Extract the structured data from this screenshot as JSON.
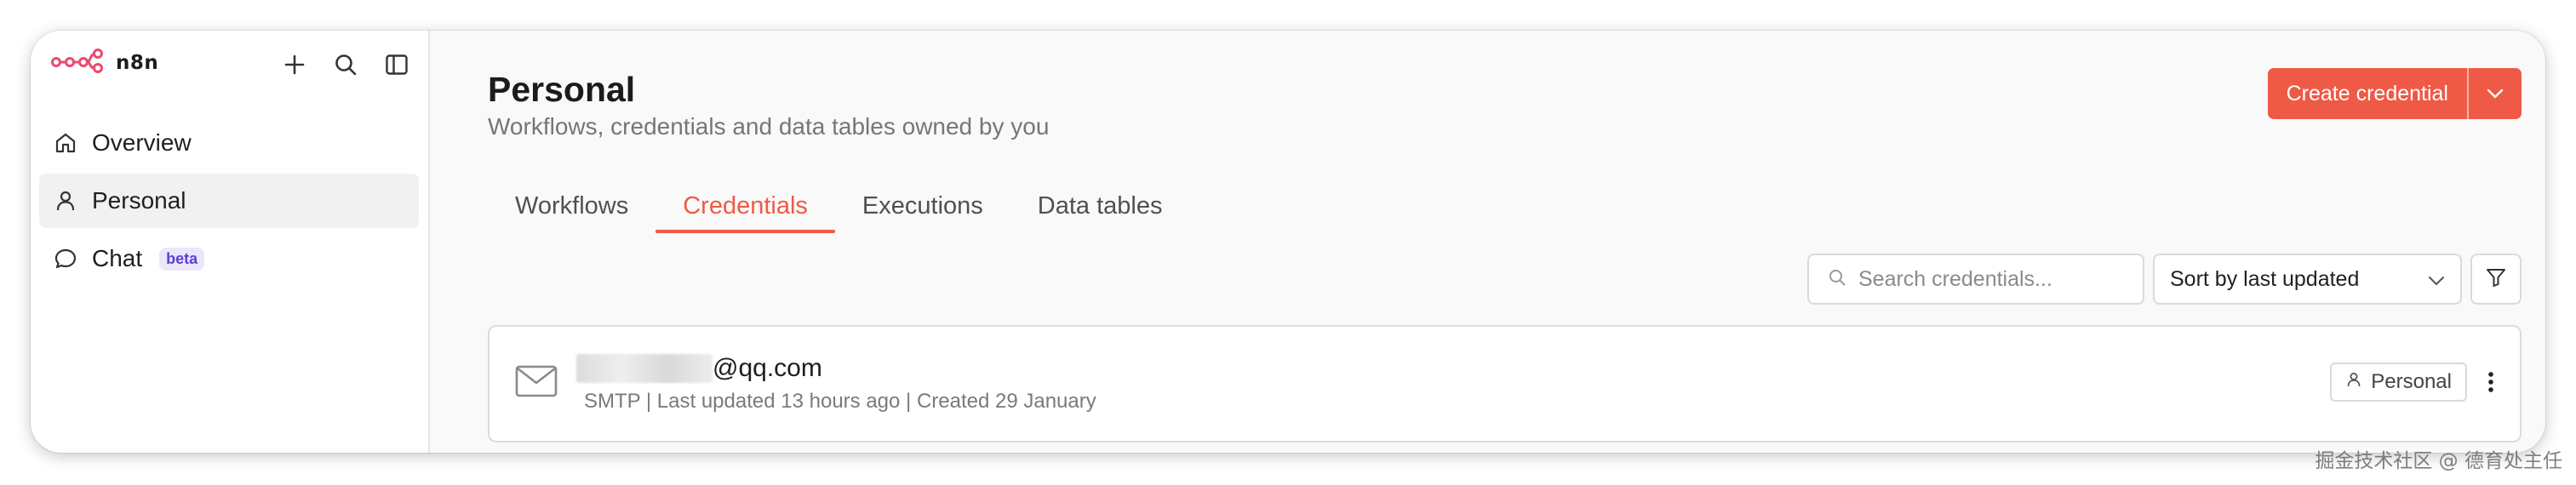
{
  "app": {
    "name": "n8n",
    "brand_color": "#ea4b71"
  },
  "sidebar": {
    "actions": [
      {
        "icon": "plus-icon"
      },
      {
        "icon": "search-icon"
      },
      {
        "icon": "sidebar-toggle-icon"
      }
    ],
    "items": [
      {
        "label": "Overview",
        "icon": "home-icon",
        "active": false
      },
      {
        "label": "Personal",
        "icon": "user-icon",
        "active": true
      },
      {
        "label": "Chat",
        "icon": "chat-icon",
        "active": false,
        "badge": "beta"
      }
    ]
  },
  "header": {
    "title": "Personal",
    "subtitle": "Workflows, credentials and data tables owned by you",
    "create_label": "Create credential"
  },
  "tabs": [
    {
      "label": "Workflows",
      "active": false
    },
    {
      "label": "Credentials",
      "active": true
    },
    {
      "label": "Executions",
      "active": false
    },
    {
      "label": "Data tables",
      "active": false
    }
  ],
  "toolbar": {
    "search_placeholder": "Search credentials...",
    "sort_label": "Sort by last updated"
  },
  "credentials": [
    {
      "name_suffix": "@qq.com",
      "meta": "SMTP | Last updated 13 hours ago | Created 29 January",
      "owner": "Personal",
      "icon": "mail-icon"
    }
  ],
  "watermark": "掘金技术社区 @ 德育处主任",
  "colors": {
    "accent": "#ee5a45",
    "badge_text": "#5b3fd6",
    "badge_bg": "#ebe6fb"
  }
}
